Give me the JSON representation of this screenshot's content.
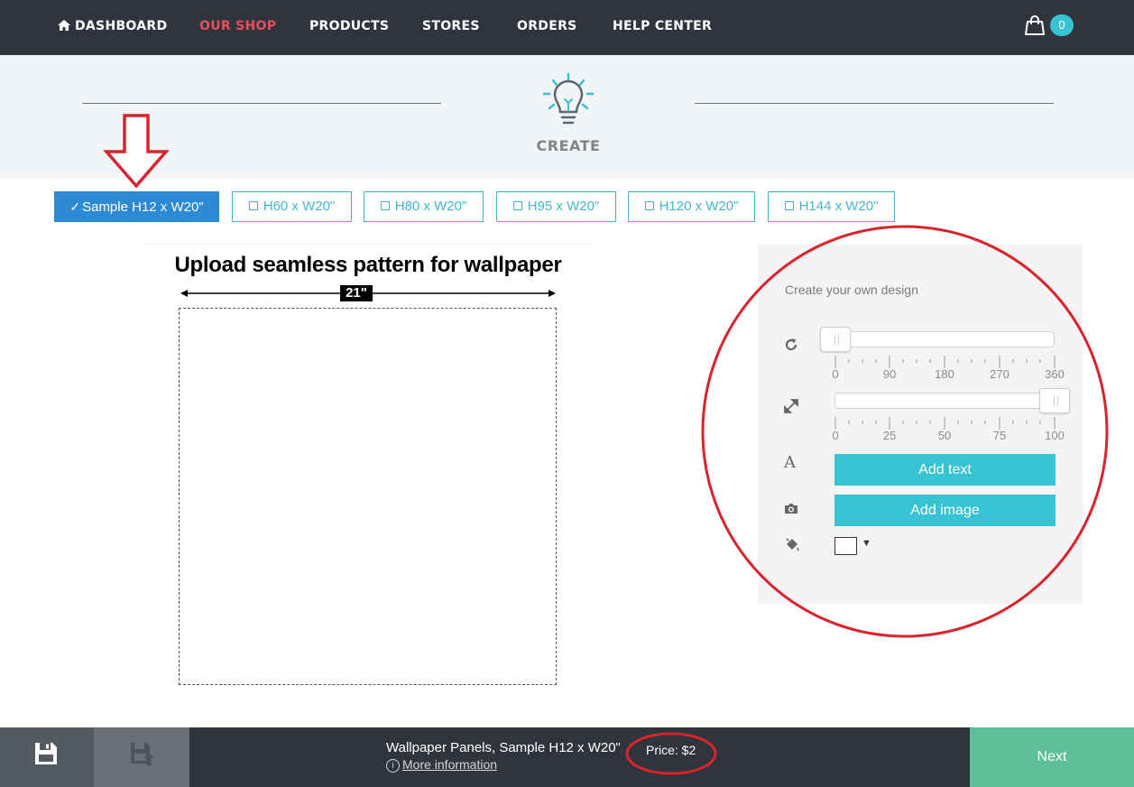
{
  "nav": {
    "items": [
      {
        "label": "DASHBOARD",
        "icon": "home-icon"
      },
      {
        "label": "OUR SHOP"
      },
      {
        "label": "PRODUCTS"
      },
      {
        "label": "STORES"
      },
      {
        "label": "ORDERS"
      },
      {
        "label": "HELP CENTER"
      }
    ],
    "active": "OUR SHOP",
    "cart_count": "0",
    "colors": {
      "bar": "#30353d",
      "active": "#e5505a",
      "badge": "#38c3d3"
    }
  },
  "header": {
    "step_title": "CREATE",
    "icon": "lightbulb-icon"
  },
  "size_tabs": [
    {
      "label": "Sample H12 x W20\"",
      "selected": true
    },
    {
      "label": "H60 x W20\"",
      "selected": false
    },
    {
      "label": "H80 x W20\"",
      "selected": false
    },
    {
      "label": "H95 x W20\"",
      "selected": false
    },
    {
      "label": "H120 x W20\"",
      "selected": false
    },
    {
      "label": "H144 x W20\"",
      "selected": false
    }
  ],
  "canvas": {
    "title": "Upload seamless pattern for wallpaper",
    "width_label": "21\""
  },
  "design_panel": {
    "title": "Create your own design",
    "rotate": {
      "icon": "rotate-icon",
      "value": 0,
      "ticks": [
        "0",
        "90",
        "180",
        "270",
        "360"
      ]
    },
    "scale": {
      "icon": "resize-icon",
      "value": 100,
      "ticks": [
        "0",
        "25",
        "50",
        "75",
        "100"
      ]
    },
    "add_text_label": "Add text",
    "add_image_label": "Add image",
    "text_icon": "font-icon",
    "image_icon": "camera-icon",
    "fill_icon": "paint-bucket-icon",
    "fill_color": "#ffffff",
    "accent": "#38c3d3"
  },
  "footer": {
    "product_name": "Wallpaper Panels, Sample H12 x W20\"",
    "more_info": "More information",
    "price": "Price: $2",
    "next_label": "Next",
    "next_color": "#5dbe97"
  }
}
